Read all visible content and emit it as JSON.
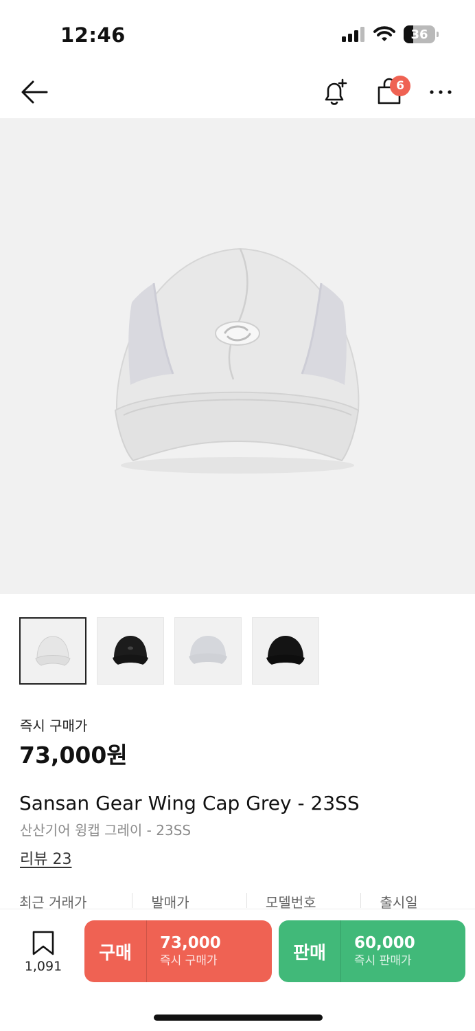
{
  "status_bar": {
    "time": "12:46",
    "battery": "36"
  },
  "nav": {
    "cart_badge": "6"
  },
  "thumbnails": [
    {
      "variant": "grey",
      "color": "#e6e6e6"
    },
    {
      "variant": "black",
      "color": "#1c1c1c"
    },
    {
      "variant": "light-grey",
      "color": "#d7d9dd"
    },
    {
      "variant": "black",
      "color": "#141414"
    }
  ],
  "product": {
    "price_label": "즉시 구매가",
    "price": "73,000원",
    "name_en": "Sansan Gear Wing Cap Grey - 23SS",
    "name_ko": "산산기어 윙캡 그레이 - 23SS",
    "reviews": "리뷰 23"
  },
  "info_row": [
    "최근 거래가",
    "발매가",
    "모델번호",
    "출시일"
  ],
  "bottom_bar": {
    "bookmark_count": "1,091",
    "buy": {
      "label": "구매",
      "price": "73,000",
      "sub": "즉시 구매가"
    },
    "sell": {
      "label": "판매",
      "price": "60,000",
      "sub": "즉시 판매가"
    }
  },
  "colors": {
    "buy": "#ef6253",
    "sell": "#41b979",
    "badge": "#ef6253"
  }
}
